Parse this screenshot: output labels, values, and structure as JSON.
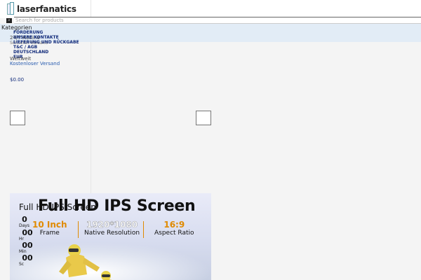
{
  "site": {
    "logo_text": "laserfanatics"
  },
  "search": {
    "placeholder": "Search for products"
  },
  "menu": {
    "heading": "Kategorien",
    "items": [
      "FÖRDERUNG",
      "UNSERE KONTAKTE",
      "LIEFERUNG UND RÜCKGABE",
      "T&C / AGB",
      "DEUTSCHLAND",
      "EUR"
    ]
  },
  "behind_text": {
    "line1": "24/7 Hotline",
    "line2": "Schneller Versand"
  },
  "shipping": {
    "region": "Weltweit",
    "free": "Kostenloser Versand"
  },
  "cart": {
    "total": "$0.00"
  },
  "banner": {
    "title": "Full HD IPS Screen",
    "ghost_title": "Full HD IPS Screen",
    "specs": [
      {
        "value": "10 Inch",
        "label": "Frame"
      },
      {
        "value": "1920*1080",
        "label": "Native Resolution"
      },
      {
        "value": "16:9",
        "label": "Aspect Ratio"
      }
    ]
  },
  "countdown": [
    {
      "value": "0",
      "unit": "Days"
    },
    {
      "value": "00",
      "unit": "Hr"
    },
    {
      "value": "00",
      "unit": "Min"
    },
    {
      "value": "00",
      "unit": "Sc"
    }
  ],
  "colors": {
    "menu_bg": "#e2ecf6",
    "menu_text": "#102a7a",
    "link": "#2a5db0",
    "accent": "#e08a00"
  },
  "icons": {
    "search": "search-icon",
    "logo": "logo-icon",
    "prev": "chevron-left-icon",
    "next": "chevron-right-icon"
  }
}
